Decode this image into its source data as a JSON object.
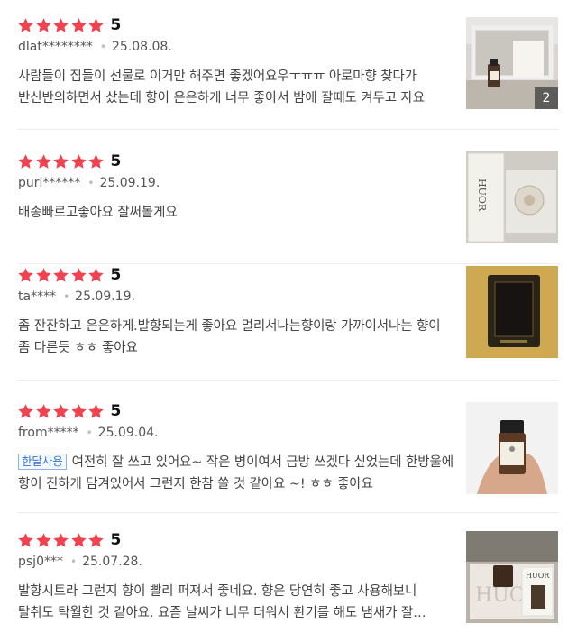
{
  "colors": {
    "star": "#f0434f",
    "badge": "#3a73c9",
    "divider": "#ededed"
  },
  "reviews": [
    {
      "rating": "5",
      "user": "dlat********",
      "date": "25.08.08.",
      "badge": "",
      "text": "사람들이 집들이 선물로 이거만 해주면 좋겠어요우ㅜㅠㅠ 아로마향 찾다가 반신반의하면서 샀는데 향이 은은하게 너무 좋아서 밤에 잘때도 켜두고 자요",
      "thumbnail": "diffuser-on-shelf-photo",
      "image_count": "2"
    },
    {
      "rating": "5",
      "user": "puri******",
      "date": "25.09.19.",
      "badge": "",
      "text": "배송빠르고좋아요 잘써볼게요",
      "thumbnail": "huor-package-photo",
      "image_count": ""
    },
    {
      "rating": "5",
      "user": "ta****",
      "date": "25.09.19.",
      "badge": "",
      "text": "좀 잔잔하고 은은하게.발향되는게 좋아요 멀리서나는향이랑 가까이서나는 향이 좀 다른듯 ㅎㅎ 좋아요",
      "thumbnail": "scent-sheet-photo",
      "image_count": ""
    },
    {
      "rating": "5",
      "user": "from*****",
      "date": "25.09.04.",
      "badge": "한달사용",
      "text": "여전히 잘 쓰고 있어요~ 작은 병이여서 금방 쓰겠다 싶었는데 한방울에 향이 진하게 담겨있어서 그런지 한참 쓸 것 같아요 ~! ㅎㅎ 좋아요",
      "thumbnail": "oil-bottle-in-hand-photo",
      "image_count": ""
    },
    {
      "rating": "5",
      "user": "psj0***",
      "date": "25.07.28.",
      "badge": "",
      "text": "발향시트라 그런지 향이 빨리 퍼져서 좋네요. 향은 당연히 좋고 사용해보니 탈취도 탁월한 것 같아요. 요즘 날씨가 너무 더워서 환기를 해도 냄새가 잘 안빠지는데",
      "thumbnail": "huor-box-and-bottle-photo",
      "image_count": ""
    }
  ]
}
